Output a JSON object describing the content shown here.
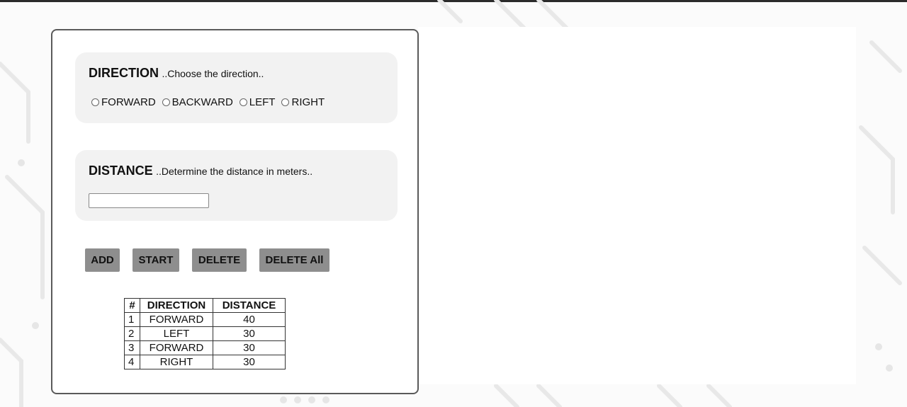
{
  "form": {
    "direction": {
      "title": "DIRECTION",
      "hint": "..Choose the direction..",
      "options": [
        "FORWARD",
        "BACKWARD",
        "LEFT",
        "RIGHT"
      ]
    },
    "distance": {
      "title": "DISTANCE",
      "hint": "..Determine the distance in meters..",
      "value": ""
    },
    "buttons": {
      "add": "ADD",
      "start": "START",
      "delete": "DELETE",
      "delete_all": "DELETE All"
    }
  },
  "table": {
    "headers": [
      "#",
      "DIRECTION",
      "DISTANCE"
    ],
    "rows": [
      [
        "1",
        "FORWARD",
        "40"
      ],
      [
        "2",
        "LEFT",
        "30"
      ],
      [
        "3",
        "FORWARD",
        "30"
      ],
      [
        "4",
        "RIGHT",
        "30"
      ]
    ]
  }
}
